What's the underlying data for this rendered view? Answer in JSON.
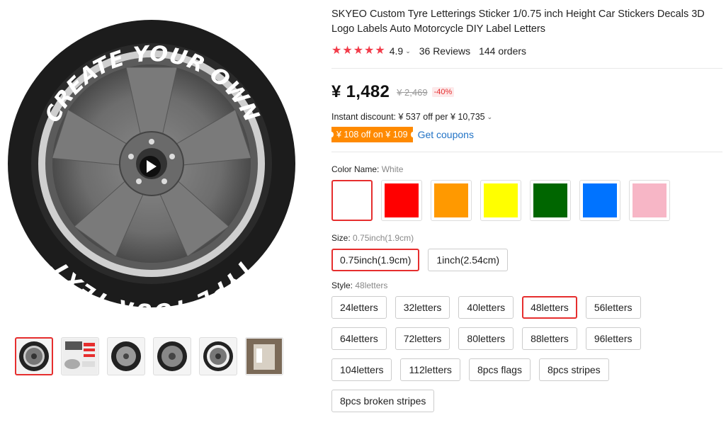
{
  "product": {
    "title": "SKYEO Custom Tyre Letterings Sticker 1/0.75 inch Height Car Stickers Decals 3D Logo Labels Auto Motorcycle DIY Label Letters",
    "rating": "4.9",
    "reviews": "36 Reviews",
    "orders": "144 orders",
    "star_color": "#f23c4a"
  },
  "image": {
    "text_top": "CREATE YOUR OWN",
    "text_bottom": "TYPE YOUR TEXT",
    "play_icon": "play-icon"
  },
  "price": {
    "current": "¥ 1,482",
    "original": "¥ 2,469",
    "discount": "-40%"
  },
  "promo": {
    "instant_discount": "Instant discount: ¥ 537 off per ¥ 10,735",
    "coupon_tag": "¥ 108 off on ¥ 109",
    "get_coupons": "Get coupons"
  },
  "color": {
    "label": "Color Name:",
    "selected": "White",
    "swatches": [
      {
        "name": "White",
        "hex": "#ffffff"
      },
      {
        "name": "Red",
        "hex": "#ff0000"
      },
      {
        "name": "Orange",
        "hex": "#ff9900"
      },
      {
        "name": "Yellow",
        "hex": "#ffff00"
      },
      {
        "name": "Green",
        "hex": "#006600"
      },
      {
        "name": "Blue",
        "hex": "#0073ff"
      },
      {
        "name": "Pink",
        "hex": "#f7b6c6"
      }
    ]
  },
  "size": {
    "label": "Size:",
    "selected": "0.75inch(1.9cm)",
    "options": [
      "0.75inch(1.9cm)",
      "1inch(2.54cm)"
    ]
  },
  "style": {
    "label": "Style:",
    "selected": "48letters",
    "options": [
      "24letters",
      "32letters",
      "40letters",
      "48letters",
      "56letters",
      "64letters",
      "72letters",
      "80letters",
      "88letters",
      "96letters",
      "104letters",
      "112letters",
      "8pcs flags",
      "8pcs stripes",
      "8pcs broken stripes"
    ]
  },
  "gallery": {
    "thumbnails": 6,
    "active_index": 0
  }
}
